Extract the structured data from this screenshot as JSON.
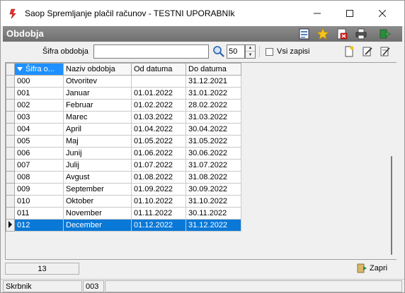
{
  "window": {
    "title": "Saop Spremljanje plačil računov - TESTNI UPORABNIk",
    "minimize": "—",
    "maximize": "☐",
    "close": "✕"
  },
  "header": {
    "title": "Obdobja",
    "icons": [
      "document-grid-icon",
      "star-icon",
      "delete-icon",
      "printer-icon",
      "exit-icon"
    ]
  },
  "filter": {
    "label": "Šifra obdobja",
    "value": "",
    "count": "50",
    "show_all_label": "Vsi zapisi",
    "show_all_checked": false
  },
  "grid": {
    "columns": [
      "Šifra o...",
      "Naziv obdobja",
      "Od datuma",
      "Do datuma"
    ],
    "rows": [
      {
        "id": "000",
        "name": "Otvoritev",
        "from": "",
        "to": "31.12.2021"
      },
      {
        "id": "001",
        "name": "Januar",
        "from": "01.01.2022",
        "to": "31.01.2022"
      },
      {
        "id": "002",
        "name": "Februar",
        "from": "01.02.2022",
        "to": "28.02.2022"
      },
      {
        "id": "003",
        "name": "Marec",
        "from": "01.03.2022",
        "to": "31.03.2022"
      },
      {
        "id": "004",
        "name": "April",
        "from": "01.04.2022",
        "to": "30.04.2022"
      },
      {
        "id": "005",
        "name": "Maj",
        "from": "01.05.2022",
        "to": "31.05.2022"
      },
      {
        "id": "006",
        "name": "Junij",
        "from": "01.06.2022",
        "to": "30.06.2022"
      },
      {
        "id": "007",
        "name": "Julij",
        "from": "01.07.2022",
        "to": "31.07.2022"
      },
      {
        "id": "008",
        "name": "Avgust",
        "from": "01.08.2022",
        "to": "31.08.2022"
      },
      {
        "id": "009",
        "name": "September",
        "from": "01.09.2022",
        "to": "30.09.2022"
      },
      {
        "id": "010",
        "name": "Oktober",
        "from": "01.10.2022",
        "to": "31.10.2022"
      },
      {
        "id": "011",
        "name": "November",
        "from": "01.11.2022",
        "to": "30.11.2022"
      },
      {
        "id": "012",
        "name": "December",
        "from": "01.12.2022",
        "to": "31.12.2022"
      }
    ],
    "selected_row": 12
  },
  "footer": {
    "record_count": "13",
    "close_label": "Zapri"
  },
  "status": {
    "user": "Skrbnik",
    "code": "003"
  },
  "colors": {
    "header_bg": "#7d7d7d",
    "selection": "#0a78d7",
    "sorted_header": "#1e90ff"
  }
}
